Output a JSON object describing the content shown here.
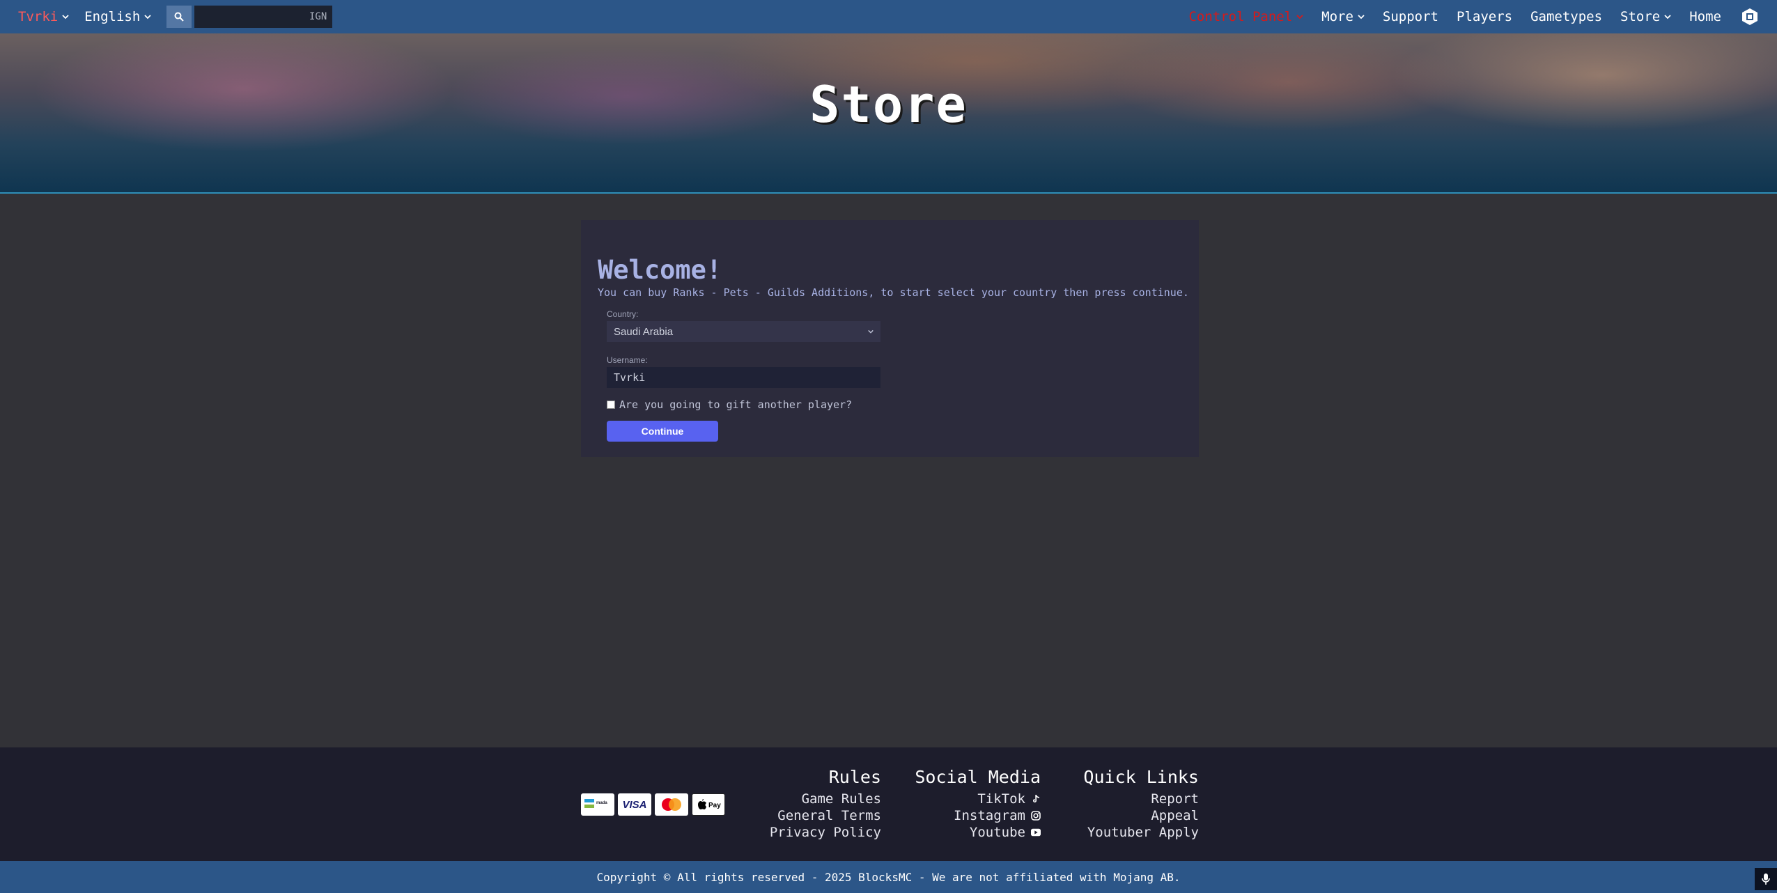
{
  "nav": {
    "user": "Tvrki",
    "language": "English",
    "search_placeholder": "IGN",
    "right": [
      {
        "label": "Control Panel",
        "dropdown": true
      },
      {
        "label": "More",
        "dropdown": true
      },
      {
        "label": "Support",
        "dropdown": false
      },
      {
        "label": "Players",
        "dropdown": false
      },
      {
        "label": "Gametypes",
        "dropdown": false
      },
      {
        "label": "Store",
        "dropdown": true
      },
      {
        "label": "Home",
        "dropdown": false
      }
    ]
  },
  "hero": {
    "title": "Store"
  },
  "form": {
    "welcome": "Welcome!",
    "intro": "You can buy Ranks - Pets - Guilds Additions, to start select your country then press continue.",
    "country_label": "Country:",
    "country_value": "Saudi Arabia",
    "username_label": "Username:",
    "username_value": "Tvrki",
    "gift_label": "Are you going to gift another player?",
    "gift_checked": false,
    "continue_label": "Continue"
  },
  "footer": {
    "payments": [
      "mada",
      "VISA",
      "Mastercard",
      "Apple Pay"
    ],
    "rules": {
      "title": "Rules",
      "links": [
        "Game Rules",
        "General Terms",
        "Privacy Policy"
      ]
    },
    "social": {
      "title": "Social Media",
      "links": [
        {
          "label": "TikTok",
          "icon": "tiktok-icon"
        },
        {
          "label": "Instagram",
          "icon": "instagram-icon"
        },
        {
          "label": "Youtube",
          "icon": "youtube-icon"
        }
      ]
    },
    "quick": {
      "title": "Quick Links",
      "links": [
        "Report",
        "Appeal",
        "Youtuber Apply"
      ]
    },
    "copyright": "Copyright © All rights reserved - 2025 BlocksMC - We are not affiliated with Mojang AB."
  },
  "colors": {
    "navbar": "#2c5688",
    "page_bg": "#323237",
    "card_bg": "#2c2b3c",
    "accent_button": "#5862f0",
    "control_panel": "#d61a1a",
    "footer_bg": "#1d1d2c"
  }
}
